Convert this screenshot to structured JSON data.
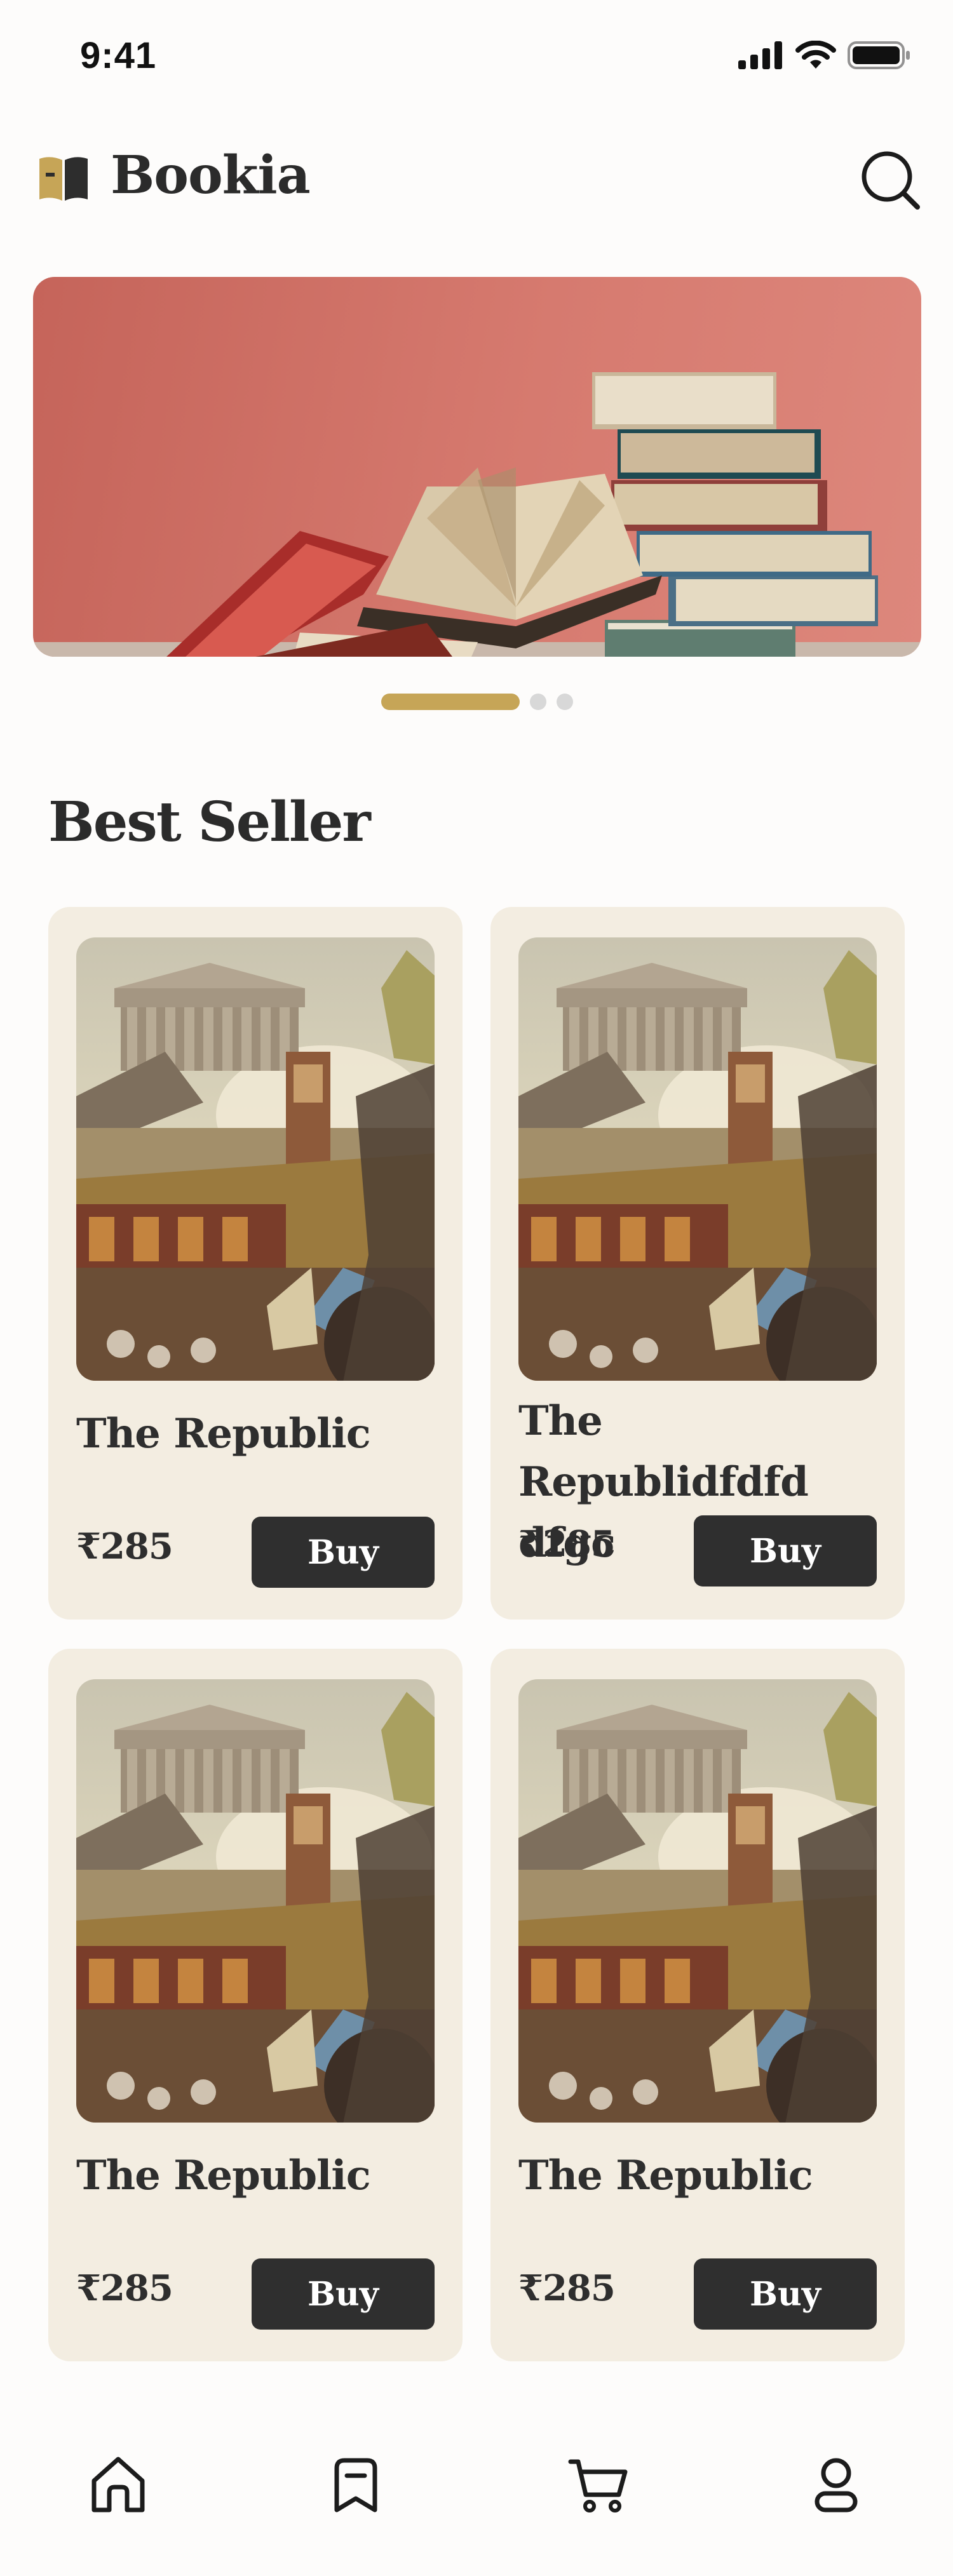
{
  "status_bar": {
    "time": "9:41"
  },
  "header": {
    "brand": "Bookia"
  },
  "banner": {
    "active_slide": 1,
    "slide_count": 3
  },
  "section": {
    "title": "Best Seller"
  },
  "products": [
    {
      "title": "The Republic",
      "price": "₹285",
      "buy_label": "Buy"
    },
    {
      "title": "The Republidfdfd dfgc",
      "price": "₹285",
      "buy_label": "Buy"
    },
    {
      "title": "The Republic",
      "price": "₹285",
      "buy_label": "Buy"
    },
    {
      "title": "The Republic",
      "price": "₹285",
      "buy_label": "Buy"
    }
  ],
  "bottom_nav": {
    "items": [
      {
        "icon": "home-icon",
        "active": true
      },
      {
        "icon": "bookmark-icon",
        "active": false
      },
      {
        "icon": "cart-icon",
        "active": false
      },
      {
        "icon": "profile-icon",
        "active": false
      }
    ]
  },
  "colors": {
    "accent": "#c6a557",
    "card_bg": "#f3ede1",
    "button_bg": "#2f2f2f",
    "banner_bg": "#d67a6f"
  }
}
